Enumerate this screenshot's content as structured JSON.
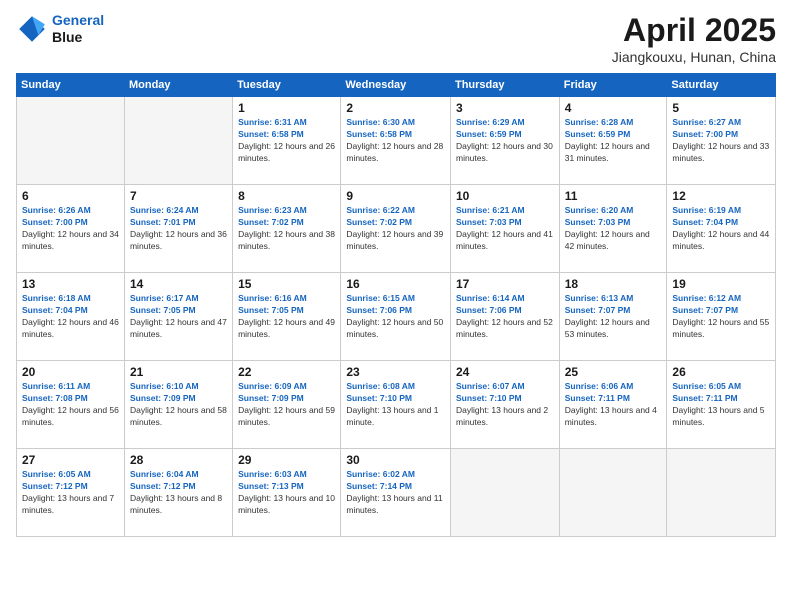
{
  "logo": {
    "line1": "General",
    "line2": "Blue"
  },
  "title": "April 2025",
  "subtitle": "Jiangkouxu, Hunan, China",
  "weekdays": [
    "Sunday",
    "Monday",
    "Tuesday",
    "Wednesday",
    "Thursday",
    "Friday",
    "Saturday"
  ],
  "weeks": [
    [
      {
        "day": "",
        "info": ""
      },
      {
        "day": "",
        "info": ""
      },
      {
        "day": "1",
        "sunrise": "6:31 AM",
        "sunset": "6:58 PM",
        "daylight": "12 hours and 26 minutes."
      },
      {
        "day": "2",
        "sunrise": "6:30 AM",
        "sunset": "6:58 PM",
        "daylight": "12 hours and 28 minutes."
      },
      {
        "day": "3",
        "sunrise": "6:29 AM",
        "sunset": "6:59 PM",
        "daylight": "12 hours and 30 minutes."
      },
      {
        "day": "4",
        "sunrise": "6:28 AM",
        "sunset": "6:59 PM",
        "daylight": "12 hours and 31 minutes."
      },
      {
        "day": "5",
        "sunrise": "6:27 AM",
        "sunset": "7:00 PM",
        "daylight": "12 hours and 33 minutes."
      }
    ],
    [
      {
        "day": "6",
        "sunrise": "6:26 AM",
        "sunset": "7:00 PM",
        "daylight": "12 hours and 34 minutes."
      },
      {
        "day": "7",
        "sunrise": "6:24 AM",
        "sunset": "7:01 PM",
        "daylight": "12 hours and 36 minutes."
      },
      {
        "day": "8",
        "sunrise": "6:23 AM",
        "sunset": "7:02 PM",
        "daylight": "12 hours and 38 minutes."
      },
      {
        "day": "9",
        "sunrise": "6:22 AM",
        "sunset": "7:02 PM",
        "daylight": "12 hours and 39 minutes."
      },
      {
        "day": "10",
        "sunrise": "6:21 AM",
        "sunset": "7:03 PM",
        "daylight": "12 hours and 41 minutes."
      },
      {
        "day": "11",
        "sunrise": "6:20 AM",
        "sunset": "7:03 PM",
        "daylight": "12 hours and 42 minutes."
      },
      {
        "day": "12",
        "sunrise": "6:19 AM",
        "sunset": "7:04 PM",
        "daylight": "12 hours and 44 minutes."
      }
    ],
    [
      {
        "day": "13",
        "sunrise": "6:18 AM",
        "sunset": "7:04 PM",
        "daylight": "12 hours and 46 minutes."
      },
      {
        "day": "14",
        "sunrise": "6:17 AM",
        "sunset": "7:05 PM",
        "daylight": "12 hours and 47 minutes."
      },
      {
        "day": "15",
        "sunrise": "6:16 AM",
        "sunset": "7:05 PM",
        "daylight": "12 hours and 49 minutes."
      },
      {
        "day": "16",
        "sunrise": "6:15 AM",
        "sunset": "7:06 PM",
        "daylight": "12 hours and 50 minutes."
      },
      {
        "day": "17",
        "sunrise": "6:14 AM",
        "sunset": "7:06 PM",
        "daylight": "12 hours and 52 minutes."
      },
      {
        "day": "18",
        "sunrise": "6:13 AM",
        "sunset": "7:07 PM",
        "daylight": "12 hours and 53 minutes."
      },
      {
        "day": "19",
        "sunrise": "6:12 AM",
        "sunset": "7:07 PM",
        "daylight": "12 hours and 55 minutes."
      }
    ],
    [
      {
        "day": "20",
        "sunrise": "6:11 AM",
        "sunset": "7:08 PM",
        "daylight": "12 hours and 56 minutes."
      },
      {
        "day": "21",
        "sunrise": "6:10 AM",
        "sunset": "7:09 PM",
        "daylight": "12 hours and 58 minutes."
      },
      {
        "day": "22",
        "sunrise": "6:09 AM",
        "sunset": "7:09 PM",
        "daylight": "12 hours and 59 minutes."
      },
      {
        "day": "23",
        "sunrise": "6:08 AM",
        "sunset": "7:10 PM",
        "daylight": "13 hours and 1 minute."
      },
      {
        "day": "24",
        "sunrise": "6:07 AM",
        "sunset": "7:10 PM",
        "daylight": "13 hours and 2 minutes."
      },
      {
        "day": "25",
        "sunrise": "6:06 AM",
        "sunset": "7:11 PM",
        "daylight": "13 hours and 4 minutes."
      },
      {
        "day": "26",
        "sunrise": "6:05 AM",
        "sunset": "7:11 PM",
        "daylight": "13 hours and 5 minutes."
      }
    ],
    [
      {
        "day": "27",
        "sunrise": "6:05 AM",
        "sunset": "7:12 PM",
        "daylight": "13 hours and 7 minutes."
      },
      {
        "day": "28",
        "sunrise": "6:04 AM",
        "sunset": "7:12 PM",
        "daylight": "13 hours and 8 minutes."
      },
      {
        "day": "29",
        "sunrise": "6:03 AM",
        "sunset": "7:13 PM",
        "daylight": "13 hours and 10 minutes."
      },
      {
        "day": "30",
        "sunrise": "6:02 AM",
        "sunset": "7:14 PM",
        "daylight": "13 hours and 11 minutes."
      },
      {
        "day": "",
        "info": ""
      },
      {
        "day": "",
        "info": ""
      },
      {
        "day": "",
        "info": ""
      }
    ]
  ]
}
